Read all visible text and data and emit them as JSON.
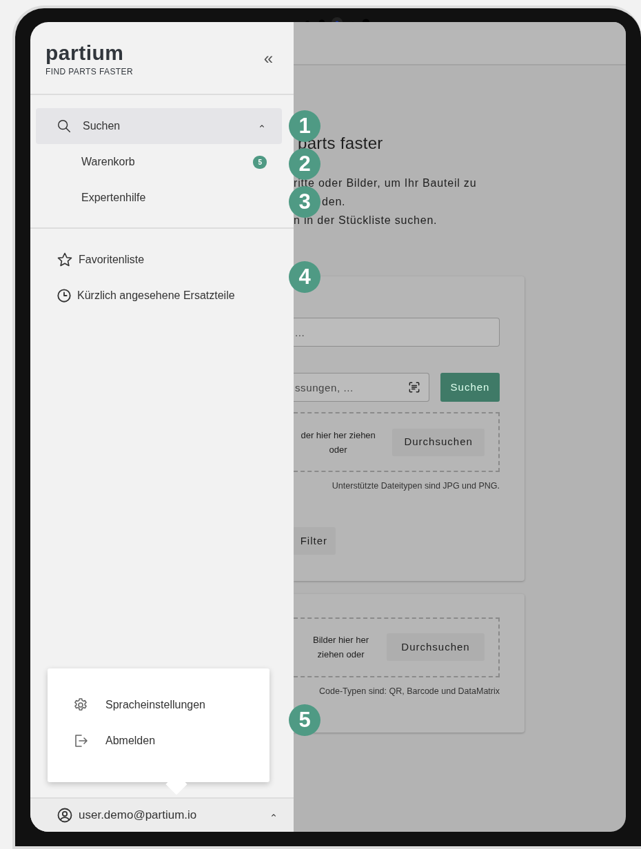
{
  "sidebar": {
    "logo": "partium",
    "tagline": "FIND PARTS FASTER",
    "collapse": "«",
    "nav": [
      {
        "label": "Suchen",
        "selected": true,
        "expanded": true,
        "children": [
          {
            "label": "Warenkorb",
            "badge": "5"
          },
          {
            "label": "Expertenhilfe"
          }
        ]
      }
    ],
    "links": [
      {
        "label": "Favoritenliste"
      },
      {
        "label": "Kürzlich angesehene Ersatzteile"
      }
    ],
    "user_menu": [
      {
        "label": "Spracheinstellungen"
      },
      {
        "label": "Abmelden"
      }
    ],
    "user": {
      "email": "user.demo@partium.io",
      "expanded": true
    }
  },
  "main": {
    "title": "parts faster",
    "intro": [
      "ritte oder Bilder, um Ihr Bauteil zu",
      "den.",
      "n in der Stückliste suchen."
    ],
    "search_card": {
      "text_placeholder": "...",
      "code_placeholder": "ssungen, ...",
      "search_button": "Suchen",
      "drop_text": "der hier her ziehen oder",
      "browse_button": "Durchsuchen",
      "hint": "Unterstützte Dateitypen sind JPG und PNG.",
      "filter_button": "Filter"
    },
    "code_card": {
      "drop_text": "Bilder hier her ziehen oder",
      "browse_button": "Durchsuchen",
      "hint": "Code-Typen sind: QR, Barcode und DataMatrix"
    }
  },
  "callouts": [
    "1",
    "2",
    "3",
    "4",
    "5"
  ]
}
